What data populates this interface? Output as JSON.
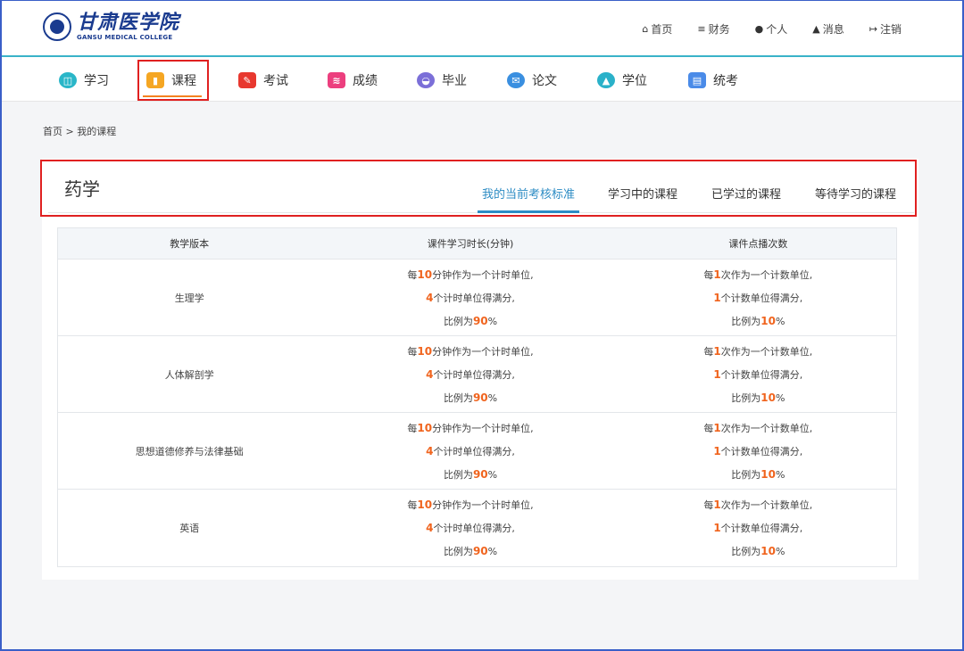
{
  "logo": {
    "cn": "甘肃医学院",
    "en": "GANSU MEDICAL COLLEGE"
  },
  "topnav": [
    {
      "icon": "home-icon",
      "glyph": "⌂",
      "label": "首页"
    },
    {
      "icon": "finance-icon",
      "glyph": "≡",
      "label": "财务"
    },
    {
      "icon": "user-icon",
      "glyph": "●",
      "label": "个人"
    },
    {
      "icon": "bell-icon",
      "glyph": "▲",
      "label": "消息"
    },
    {
      "icon": "logout-icon",
      "glyph": "↦",
      "label": "注销"
    }
  ],
  "mainnav": [
    {
      "label": "学习",
      "icon": "study-book-icon",
      "color": "#29b6c8"
    },
    {
      "label": "课程",
      "icon": "course-icon",
      "color": "#f5a623"
    },
    {
      "label": "考试",
      "icon": "exam-pen-icon",
      "color": "#e8382f"
    },
    {
      "label": "成绩",
      "icon": "grade-icon",
      "color": "#ec3f7e"
    },
    {
      "label": "毕业",
      "icon": "graduation-icon",
      "color": "#7b6fd8"
    },
    {
      "label": "论文",
      "icon": "thesis-icon",
      "color": "#3a8fe0"
    },
    {
      "label": "学位",
      "icon": "degree-cap-icon",
      "color": "#2ab1c9"
    },
    {
      "label": "统考",
      "icon": "unified-exam-icon",
      "color": "#4a8be8"
    }
  ],
  "active_nav": "课程",
  "breadcrumb": "首页 > 我的课程",
  "major": "药学",
  "tabs": [
    "我的当前考核标准",
    "学习中的课程",
    "已学过的课程",
    "等待学习的课程"
  ],
  "active_tab": "我的当前考核标准",
  "table": {
    "headers": [
      "教学版本",
      "课件学习时长(分钟)",
      "课件点播次数"
    ],
    "rows": [
      {
        "course": "生理学"
      },
      {
        "course": "人体解剖学"
      },
      {
        "course": "思想道德修养与法律基础"
      },
      {
        "course": "英语"
      }
    ],
    "duration_rule": {
      "l1_pre": "每",
      "l1_num": "10",
      "l1_post": "分钟作为一个计时单位,",
      "l2_num": "4",
      "l2_post": "个计时单位得满分,",
      "l3_pre": "比例为",
      "l3_num": "90",
      "l3_post": "%"
    },
    "count_rule": {
      "l1_pre": "每",
      "l1_num": "1",
      "l1_post": "次作为一个计数单位,",
      "l2_num": "1",
      "l2_post": "个计数单位得满分,",
      "l3_pre": "比例为",
      "l3_num": "10",
      "l3_post": "%"
    }
  },
  "colors": {
    "accent": "#2d8cc4",
    "highlight": "#f0641e",
    "header_line": "#3ab3c9",
    "annotation": "#e02020"
  }
}
